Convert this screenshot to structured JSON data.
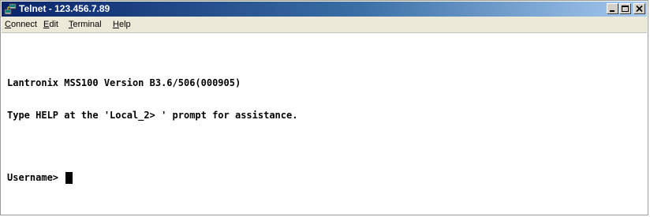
{
  "window": {
    "title": "Telnet - 123.456.7.89",
    "icon": "telnet-app-icon",
    "controls": [
      "minimize-icon",
      "maximize-icon",
      "close-icon"
    ]
  },
  "menu": {
    "connect": {
      "accel": "C",
      "rest": "onnect"
    },
    "edit": {
      "accel": "E",
      "rest": "dit"
    },
    "terminal": {
      "accel": "T",
      "rest": "erminal"
    },
    "help": {
      "accel": "H",
      "rest": "elp"
    }
  },
  "terminal": {
    "line1": "Lantronix MSS100 Version B3.6/506(000905)",
    "line2": "Type HELP at the 'Local_2> ' prompt for assistance.",
    "prompt": "Username> "
  },
  "colors": {
    "titlebar_start": "#0a246a",
    "titlebar_end": "#a6caf0",
    "menubar": "#ece9d8",
    "terminal_bg": "#ffffff",
    "terminal_fg": "#000000"
  }
}
